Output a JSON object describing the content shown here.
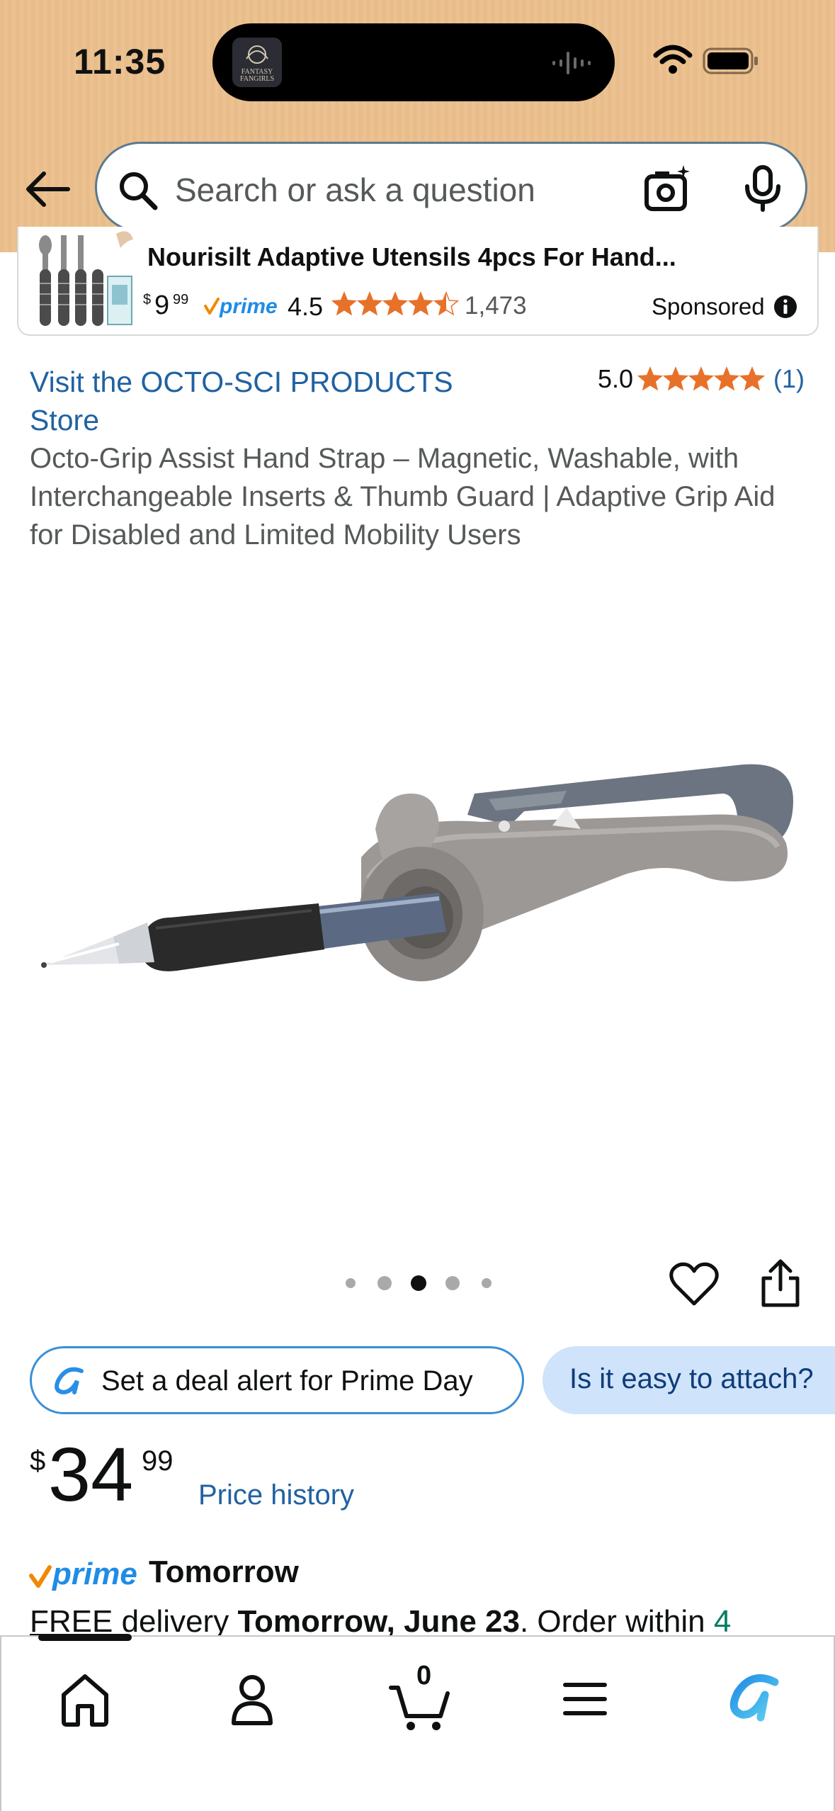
{
  "status_bar": {
    "time": "11:35",
    "activity_label": "FANTASY FANGIRLS"
  },
  "search": {
    "placeholder": "Search or ask a question"
  },
  "sponsored": {
    "title": "Nourisilt Adaptive Utensils 4pcs For Hand...",
    "price_symbol": "$",
    "price_whole": "9",
    "price_fraction": "99",
    "prime_label": "prime",
    "rating": "4.5",
    "stars": 4.5,
    "review_count": "1,473",
    "label": "Sponsored"
  },
  "product": {
    "store_link": "Visit the OCTO-SCI PRODUCTS Store",
    "rating": "5.0",
    "stars": 5,
    "review_count": "(1)",
    "title": "Octo-Grip Assist Hand Strap – Magnetic, Washable, with Interchangeable Inserts & Thumb Guard | Adaptive Grip Aid for Disabled and Limited Mobility Users",
    "image_count": 5,
    "active_image": 3
  },
  "chips": {
    "deal_alert": "Set a deal alert for Prime Day",
    "ask": "Is it easy to attach?"
  },
  "price": {
    "symbol": "$",
    "whole": "34",
    "fraction": "99",
    "history_link": "Price history"
  },
  "delivery": {
    "prime_label": "prime",
    "speed": "Tomorrow",
    "free": "FREE",
    "text1": " delivery ",
    "date": "Tomorrow, June 23",
    "text2": ". Order within ",
    "countdown": "4"
  },
  "tabbar": {
    "cart_count": "0",
    "items": [
      "home-icon",
      "account-icon",
      "cart-icon",
      "menu-icon",
      "rufus-icon"
    ]
  },
  "colors": {
    "header_bg": "#e9bd8a",
    "link": "#2162a1",
    "star": "#e8712a",
    "prime": "#1f8ce6",
    "chip_border": "#3a8fd5",
    "chip_fill": "#cfe3fb"
  }
}
